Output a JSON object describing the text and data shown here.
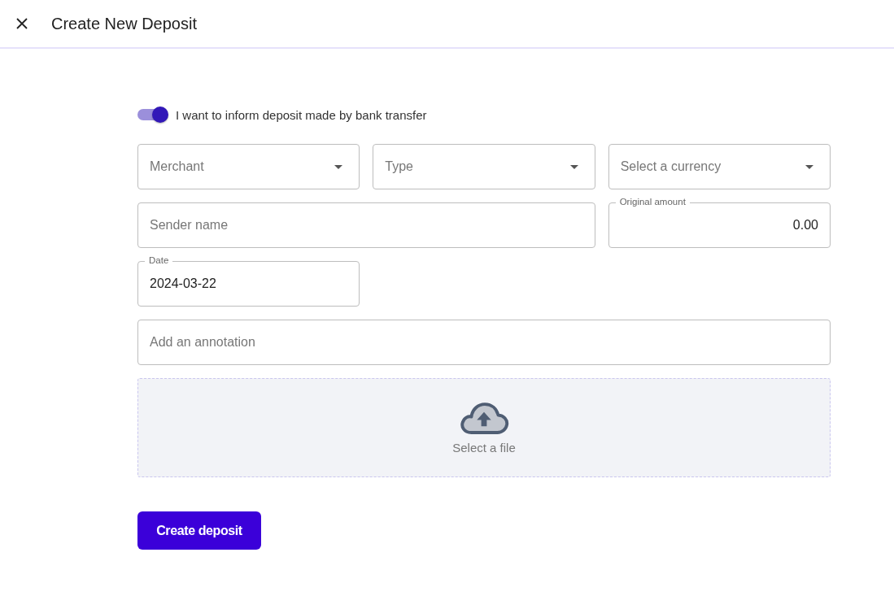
{
  "header": {
    "title": "Create New Deposit"
  },
  "toggle": {
    "label": "I want to inform deposit made by bank transfer",
    "on": true
  },
  "selects": [
    {
      "placeholder": "Merchant"
    },
    {
      "placeholder": "Type"
    },
    {
      "placeholder": "Select a currency"
    }
  ],
  "sender": {
    "placeholder": "Sender name"
  },
  "amount": {
    "label": "Original amount",
    "value": "0.00"
  },
  "date": {
    "label": "Date",
    "value": "2024-03-22"
  },
  "annotation": {
    "placeholder": "Add an annotation"
  },
  "upload": {
    "label": "Select a file"
  },
  "submit": {
    "label": "Create deposit"
  }
}
